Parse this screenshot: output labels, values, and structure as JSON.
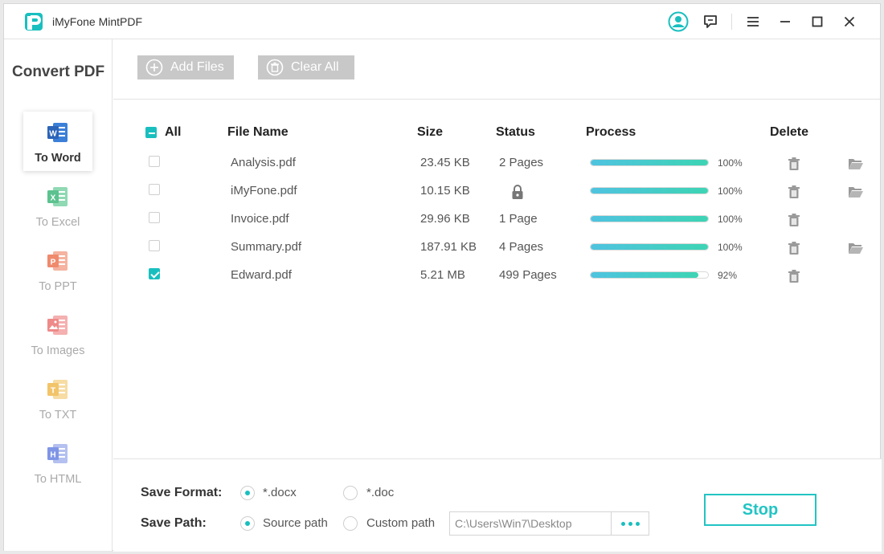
{
  "app": {
    "title": "iMyFone MintPDF"
  },
  "sidebar": {
    "title": "Convert PDF",
    "items": [
      {
        "label": "To Word",
        "letter": "W",
        "color": "#3b7fd8",
        "active": true
      },
      {
        "label": "To Excel",
        "letter": "X",
        "color": "#5cc28f",
        "active": false
      },
      {
        "label": "To PPT",
        "letter": "P",
        "color": "#ef8a6d",
        "active": false
      },
      {
        "label": "To Images",
        "letter": "",
        "color": "#ef8a8a",
        "active": false
      },
      {
        "label": "To TXT",
        "letter": "T",
        "color": "#f2c46a",
        "active": false
      },
      {
        "label": "To HTML",
        "letter": "H",
        "color": "#7f95e6",
        "active": false
      }
    ]
  },
  "toolbar": {
    "add_files": "Add Files",
    "clear_all": "Clear All"
  },
  "table": {
    "headers": {
      "all": "All",
      "file_name": "File Name",
      "size": "Size",
      "status": "Status",
      "process": "Process",
      "delete": "Delete"
    },
    "rows": [
      {
        "name": "Analysis.pdf",
        "size": "23.45 KB",
        "status": "2 Pages",
        "progress": 100,
        "pct": "100%",
        "checked": false,
        "folder": true,
        "locked": false
      },
      {
        "name": "iMyFone.pdf",
        "size": "10.15 KB",
        "status": "",
        "progress": 100,
        "pct": "100%",
        "checked": false,
        "folder": true,
        "locked": true
      },
      {
        "name": "Invoice.pdf",
        "size": "29.96 KB",
        "status": "1 Page",
        "progress": 100,
        "pct": "100%",
        "checked": false,
        "folder": false,
        "locked": false
      },
      {
        "name": "Summary.pdf",
        "size": "187.91 KB",
        "status": "4 Pages",
        "progress": 100,
        "pct": "100%",
        "checked": false,
        "folder": true,
        "locked": false
      },
      {
        "name": "Edward.pdf",
        "size": "5.21 MB",
        "status": "499 Pages",
        "progress": 92,
        "pct": "92%",
        "checked": true,
        "folder": false,
        "locked": false
      }
    ]
  },
  "bottom": {
    "save_format_label": "Save Format:",
    "format_docx": "*.docx",
    "format_doc": "*.doc",
    "selected_format": "docx",
    "save_path_label": "Save Path:",
    "source_path": "Source path",
    "custom_path": "Custom path",
    "selected_path": "source",
    "path_value": "C:\\Users\\Win7\\Desktop",
    "stop": "Stop"
  },
  "colors": {
    "accent": "#19bfbf",
    "button_disabled": "#c8c8c8"
  }
}
